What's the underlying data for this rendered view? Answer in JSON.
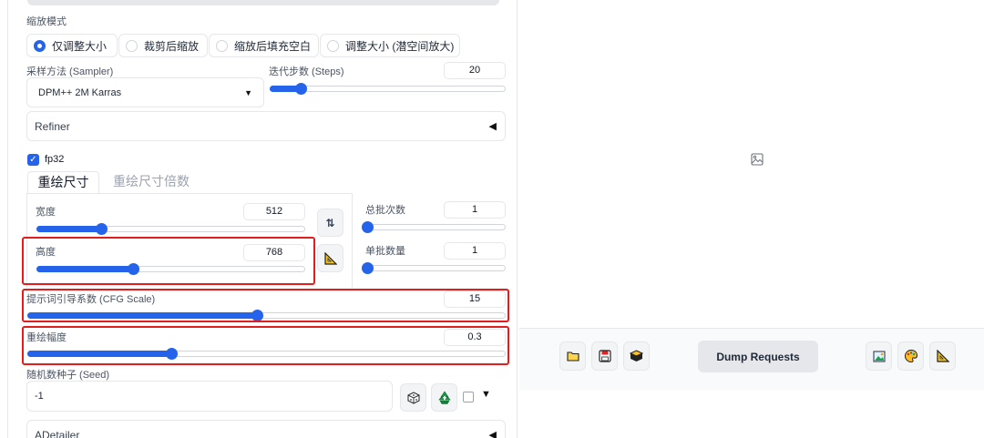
{
  "resize_mode": {
    "label": "缩放模式",
    "options": [
      "仅调整大小",
      "裁剪后缩放",
      "缩放后填充空白",
      "调整大小 (潜空间放大)"
    ],
    "selected_index": 0
  },
  "sampler": {
    "label": "采样方法 (Sampler)",
    "value": "DPM++ 2M Karras"
  },
  "steps": {
    "label": "迭代步数 (Steps)",
    "value": "20",
    "fraction": 0.13
  },
  "refiner": {
    "label": "Refiner"
  },
  "fp32": {
    "label": "fp32",
    "checked": true
  },
  "tabs": [
    {
      "label": "重绘尺寸",
      "active": true
    },
    {
      "label": "重绘尺寸倍数",
      "active": false
    }
  ],
  "width": {
    "label": "宽度",
    "value": "512",
    "fraction": 0.24
  },
  "height": {
    "label": "高度",
    "value": "768",
    "fraction": 0.36
  },
  "batch_count": {
    "label": "总批次数",
    "value": "1",
    "fraction": 0.0
  },
  "batch_size": {
    "label": "单批数量",
    "value": "1",
    "fraction": 0.0
  },
  "cfg_scale": {
    "label": "提示词引导系数 (CFG Scale)",
    "value": "15",
    "fraction": 0.48
  },
  "denoising": {
    "label": "重绘幅度",
    "value": "0.3",
    "fraction": 0.3
  },
  "seed": {
    "label": "随机数种子 (Seed)",
    "value": "-1"
  },
  "adetailer": {
    "label": "ADetailer"
  },
  "output_toolbar": {
    "dump_label": "Dump Requests"
  },
  "colors": {
    "accent": "#2563eb",
    "highlight": "#e11d1d"
  },
  "icons": [
    "swap-icon",
    "ruler-triangle-icon",
    "dice-icon",
    "recycle-icon",
    "image-placeholder-icon",
    "folder-icon",
    "save-icon",
    "package-icon",
    "picture-icon",
    "palette-icon"
  ]
}
